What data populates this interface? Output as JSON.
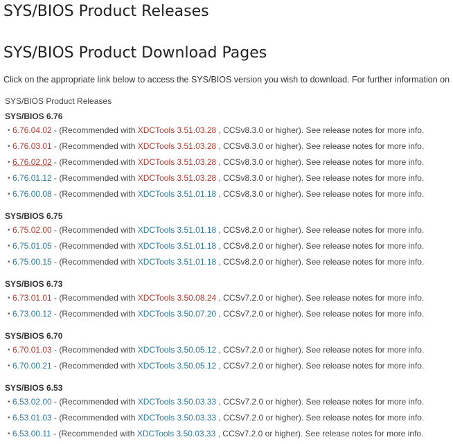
{
  "colors": {
    "link_red": "#b03a2e",
    "link_teal": "#2b7a9c",
    "text": "#444444"
  },
  "header": {
    "title": "SYS/BIOS Product Releases",
    "subtitle": "SYS/BIOS Product Download Pages",
    "intro": "Click on the appropriate link below to access the SYS/BIOS version you wish to download. For further information on"
  },
  "caption": "SYS/BIOS Product Releases",
  "groups": [
    {
      "heading": "SYS/BIOS 6.76",
      "items": [
        {
          "bullet": "•",
          "version": "6.76.04.02",
          "version_color": "red",
          "pre": " - (Recommended with ",
          "xdc": "XDCTools 3.51.03.28",
          "xdc_color": "red",
          "post": " , CCSv8.3.0 or higher). See release notes for more info."
        },
        {
          "bullet": "•",
          "version": "6.76.03.01",
          "version_color": "red",
          "pre": " - (Recommended with ",
          "xdc": "XDCTools 3.51.03.28",
          "xdc_color": "red",
          "post": " , CCSv8.3.0 or higher). See release notes for more info."
        },
        {
          "bullet": "•",
          "version": "6.76.02.02",
          "version_color": "red",
          "active": true,
          "pre": " - (Recommended with ",
          "xdc": "XDCTools 3.51.03.28",
          "xdc_color": "red",
          "post": " , CCSv8.3.0 or higher). See release notes for more info."
        },
        {
          "bullet": "•",
          "version": "6.76.01.12",
          "version_color": "teal",
          "pre": " - (Recommended with ",
          "xdc": "XDCTools 3.51.03.28",
          "xdc_color": "red",
          "post": " , CCSv8.3.0 or higher). See release notes for more info."
        },
        {
          "bullet": "•",
          "version": "6.76.00.08",
          "version_color": "teal",
          "pre": " - (Recommended with ",
          "xdc": "XDCTools 3.51.01.18",
          "xdc_color": "teal",
          "post": " , CCSv8.3.0 or higher). See release notes for more info."
        }
      ]
    },
    {
      "heading": "SYS/BIOS 6.75",
      "items": [
        {
          "bullet": "•",
          "version": "6.75.02.00",
          "version_color": "red",
          "pre": " - (Recommended with ",
          "xdc": "XDCTools 3.51.01.18",
          "xdc_color": "teal",
          "post": " , CCSv8.2.0 or higher). See release notes for more info."
        },
        {
          "bullet": "•",
          "version": "6.75.01.05",
          "version_color": "teal",
          "pre": " - (Recommended with ",
          "xdc": "XDCTools 3.51.01.18",
          "xdc_color": "teal",
          "post": " , CCSv8.2.0 or higher). See release notes for more info."
        },
        {
          "bullet": "•",
          "version": "6.75.00.15",
          "version_color": "teal",
          "pre": " - (Recommended with ",
          "xdc": "XDCTools 3.51.01.18",
          "xdc_color": "teal",
          "post": " , CCSv8.2.0 or higher). See release notes for more info."
        }
      ]
    },
    {
      "heading": "SYS/BIOS 6.73",
      "items": [
        {
          "bullet": "•",
          "version": "6.73.01.01",
          "version_color": "red",
          "pre": " - (Recommended with ",
          "xdc": "XDCTools 3.50.08.24",
          "xdc_color": "red",
          "post": " , CCSv7.2.0 or higher). See release notes for more info."
        },
        {
          "bullet": "•",
          "version": "6.73.00.12",
          "version_color": "teal",
          "pre": " - (Recommended with ",
          "xdc": "XDCTools 3.50.07.20",
          "xdc_color": "teal",
          "post": " , CCSv7.2.0 or higher). See release notes for more info."
        }
      ]
    },
    {
      "heading": "SYS/BIOS 6.70",
      "items": [
        {
          "bullet": "•",
          "version": "6.70.01.03",
          "version_color": "red",
          "pre": " - (Recommended with ",
          "xdc": "XDCTools 3.50.05.12",
          "xdc_color": "teal",
          "post": " , CCSv7.2.0 or higher). See release notes for more info."
        },
        {
          "bullet": "•",
          "version": "6.70.00.21",
          "version_color": "teal",
          "pre": " - (Recommended with ",
          "xdc": "XDCTools 3.50.05.12",
          "xdc_color": "teal",
          "post": " , CCSv7.2.0 or higher). See release notes for more info."
        }
      ]
    },
    {
      "heading": "SYS/BIOS 6.53",
      "items": [
        {
          "bullet": "•",
          "version": "6.53.02.00",
          "version_color": "teal",
          "pre": " - (Recommended with ",
          "xdc": "XDCTools 3.50.03.33",
          "xdc_color": "teal",
          "post": " , CCSv7.2.0 or higher). See release notes for more info."
        },
        {
          "bullet": "•",
          "version": "6.53.01.03",
          "version_color": "teal",
          "pre": " - (Recommended with ",
          "xdc": "XDCTools 3.50.03.33",
          "xdc_color": "teal",
          "post": " , CCSv7.2.0 or higher). See release notes for more info."
        },
        {
          "bullet": "•",
          "version": "6.53.00.11",
          "version_color": "teal",
          "pre": " - (Recommended with ",
          "xdc": "XDCTools 3.50.03.33",
          "xdc_color": "teal",
          "post": " , CCSv7.2.0 or higher). See release notes for more info."
        }
      ]
    }
  ]
}
